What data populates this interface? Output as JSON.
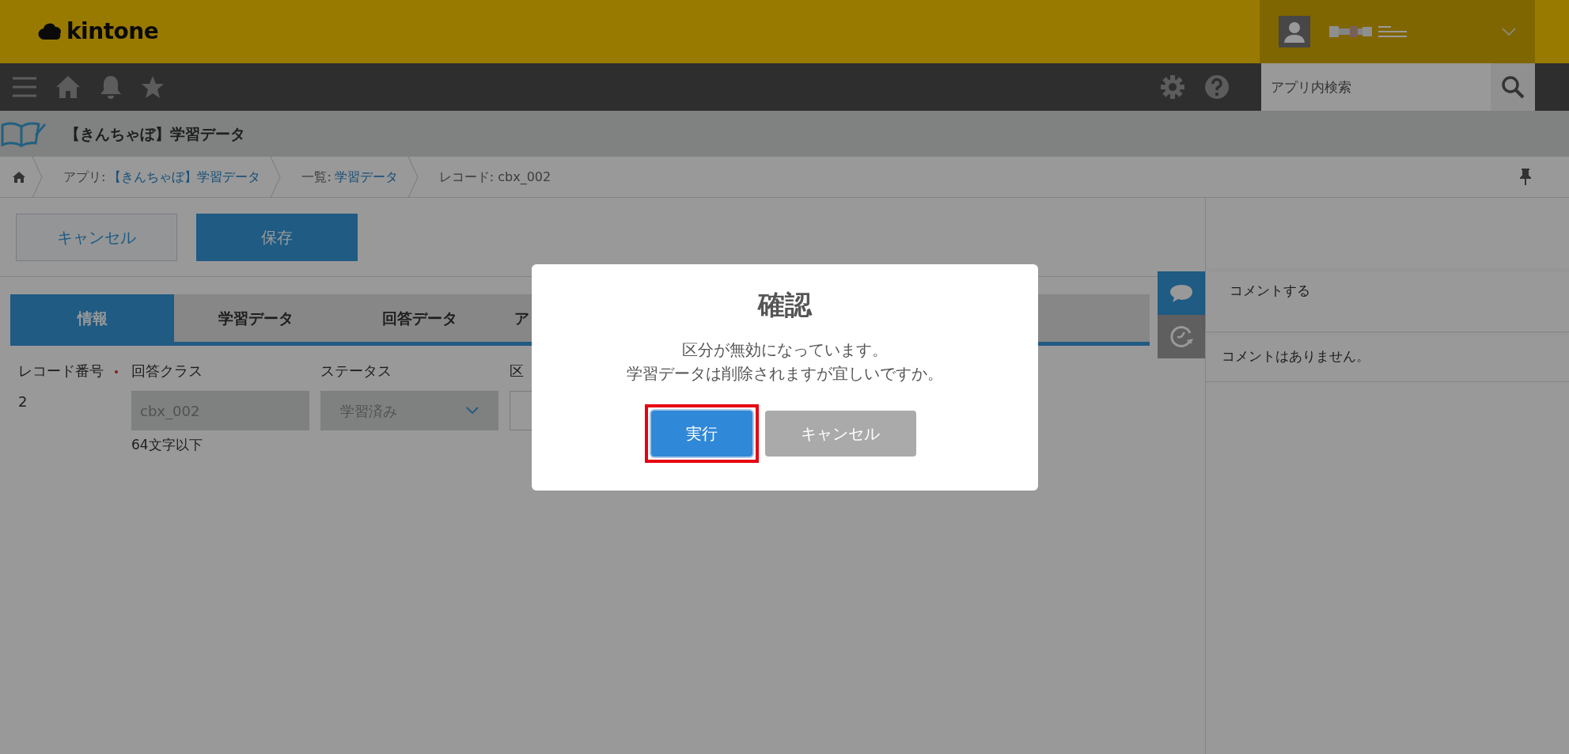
{
  "header": {
    "logo": "kintone"
  },
  "navbar": {
    "search": {
      "placeholder": "アプリ内検索"
    }
  },
  "app": {
    "title": "【きんちゃぼ】学習データ"
  },
  "breadcrumb": [
    {
      "label": "アプリ:",
      "link": "【きんちゃぼ】学習データ"
    },
    {
      "label": "一覧:",
      "link": "学習データ"
    },
    {
      "label": "レコード: cbx_002"
    }
  ],
  "toolbar": [
    {
      "label": "キャンセル",
      "kind": "secondary"
    },
    {
      "label": "保存",
      "kind": "primary"
    }
  ],
  "tabs": [
    {
      "label": "情報",
      "selected": true
    },
    {
      "label": "学習データ",
      "selected": false
    },
    {
      "label": "回答データ",
      "selected": false
    },
    {
      "label": "ア",
      "selected": false
    }
  ],
  "fields": [
    {
      "kind": "text",
      "label": "レコード番号",
      "value": "2"
    },
    {
      "kind": "input",
      "label": "回答クラス",
      "value": "cbx_002",
      "disabled": true,
      "hint": "64文字以下"
    },
    {
      "kind": "select",
      "label": "ステータス",
      "value": "学習済み",
      "disabled": true
    },
    {
      "kind": "input",
      "label": "区"
    }
  ],
  "side_tabs": [
    {
      "kind": "comment",
      "selected": true
    },
    {
      "kind": "history",
      "selected": false
    }
  ],
  "comments": {
    "placeholder": "コメントする",
    "empty": "コメントはありません。"
  },
  "dialog": {
    "title": "確認",
    "message": [
      "区分が無効になっています。",
      "学習データは削除されますが宜しいですか。"
    ],
    "buttons": [
      {
        "label": "実行",
        "kind": "primary",
        "highlighted": true
      },
      {
        "label": "キャンセル",
        "kind": "secondary",
        "highlighted": false
      }
    ]
  }
}
